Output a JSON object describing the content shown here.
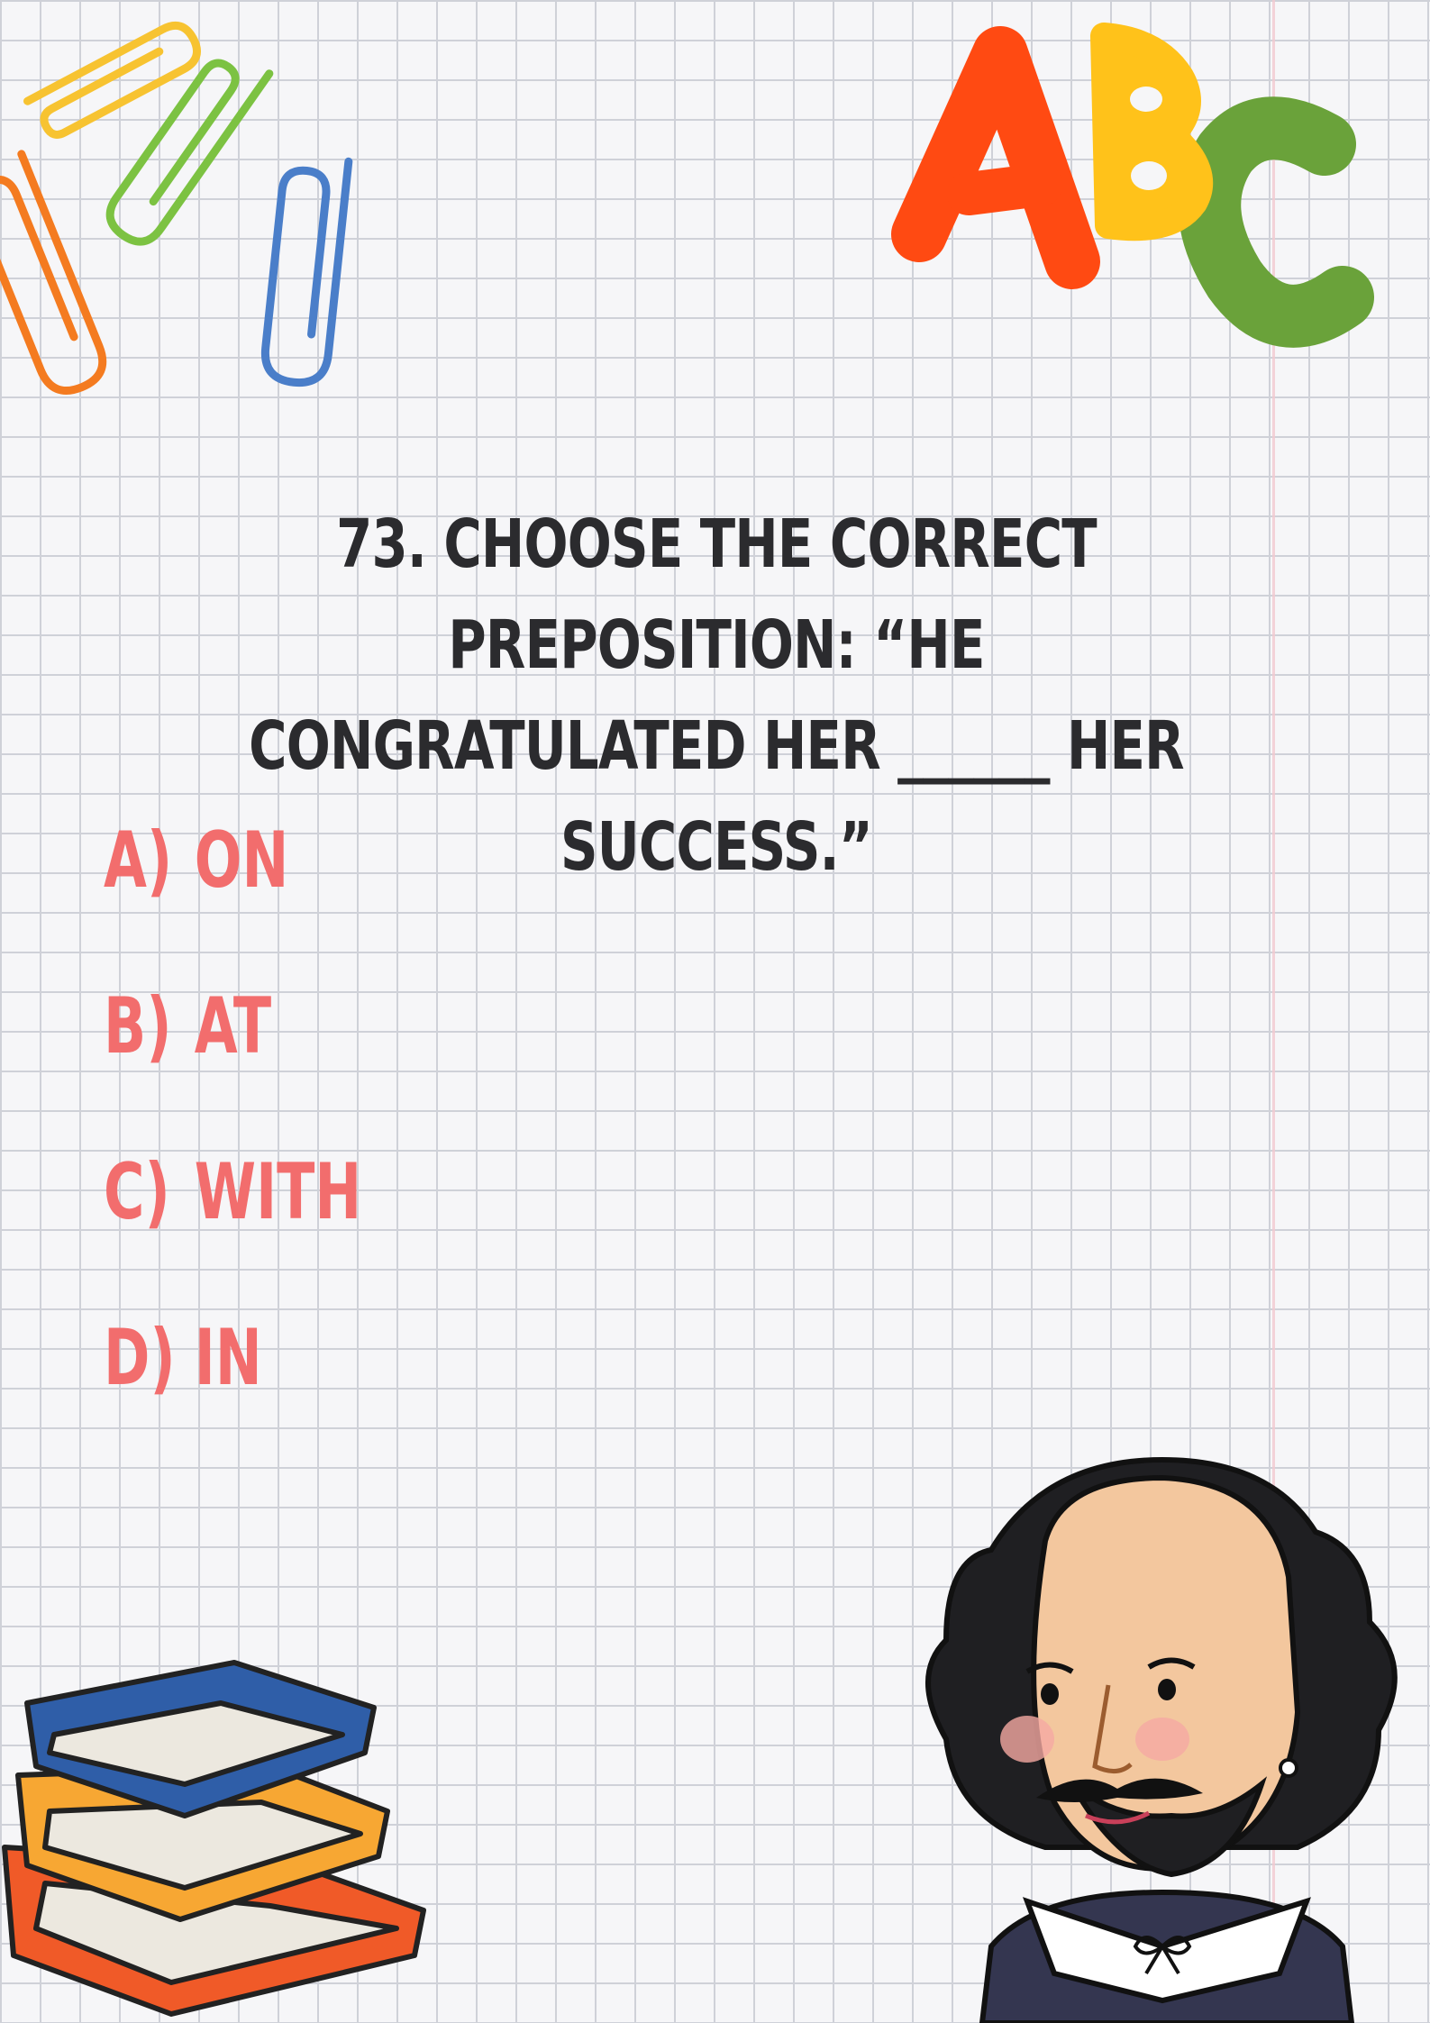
{
  "question": {
    "line1": "73. CHOOSE THE CORRECT PREPOSITION: “HE",
    "line2": "CONGRATULATED HER ______ HER",
    "line3": "SUCCESS.”"
  },
  "options": [
    {
      "letter": "A)",
      "text": "ON"
    },
    {
      "letter": "B)",
      "text": "AT"
    },
    {
      "letter": "C)",
      "text": "WITH"
    },
    {
      "letter": "D)",
      "text": "IN"
    }
  ],
  "decorations": {
    "abc_letters": "ABC",
    "colors": {
      "question_text": "#2b2b2e",
      "option_text": "#f26d6d",
      "letter_a": "#ff4a12",
      "letter_b": "#ffc21a",
      "letter_c": "#6aa23a",
      "clip_yellow": "#f7c331",
      "clip_green": "#7cc242",
      "clip_orange": "#f47b20",
      "clip_blue": "#4a7ec9",
      "book_blue": "#2f5ea8",
      "book_yellow": "#f7a733",
      "book_orange": "#f05a28"
    },
    "icons": [
      "paperclip-icon",
      "abc-letters-icon",
      "books-stack-icon",
      "shakespeare-portrait-icon"
    ]
  }
}
